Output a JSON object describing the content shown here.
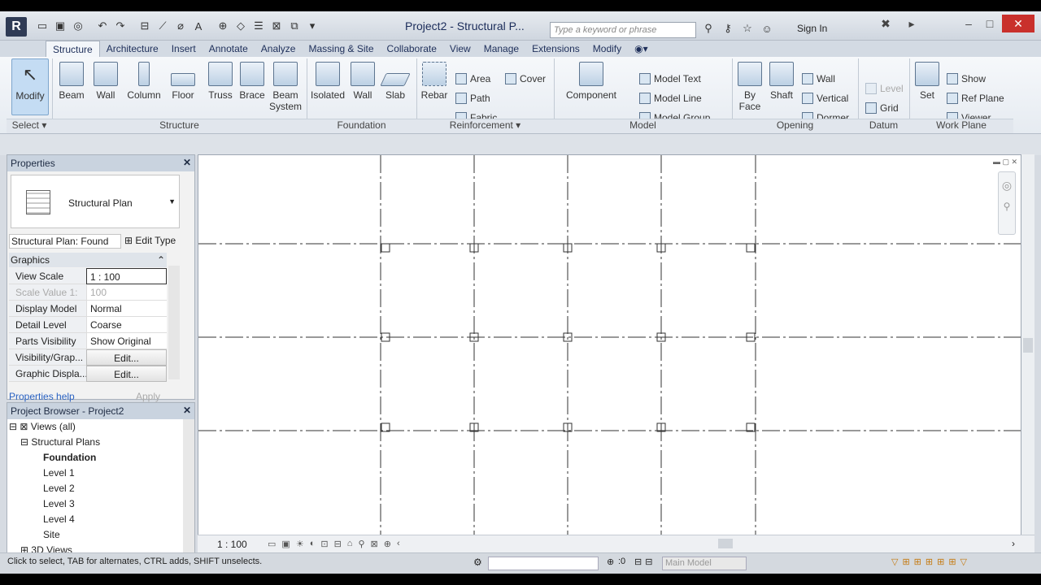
{
  "titlebar": {
    "logo": "R",
    "title": "Project2 - Structural P...",
    "search_placeholder": "Type a keyword or phrase",
    "sign_in": "Sign In"
  },
  "tabs": [
    "Structure",
    "Architecture",
    "Insert",
    "Annotate",
    "Analyze",
    "Massing & Site",
    "Collaborate",
    "View",
    "Manage",
    "Extensions",
    "Modify"
  ],
  "ribbon": {
    "modify": "Modify",
    "structure_buttons": [
      "Beam",
      "Wall",
      "Column",
      "Floor",
      "Truss",
      "Brace"
    ],
    "beam_system": [
      "Beam",
      "System"
    ],
    "foundation_buttons": [
      "Isolated",
      "Wall",
      "Slab"
    ],
    "rebar": "Rebar",
    "reinf_small": [
      "Area",
      "Path",
      "Fabric"
    ],
    "cover": "Cover",
    "component": "Component",
    "model_small": [
      "Model  Text",
      "Model  Line",
      "Model  Group"
    ],
    "by_face": [
      "By",
      "Face"
    ],
    "shaft": "Shaft",
    "opening_small": [
      "Wall",
      "Vertical",
      "Dormer"
    ],
    "level": "Level",
    "grid": "Grid",
    "set": "Set",
    "workplane_small": [
      "Show",
      "Ref  Plane",
      "Viewer"
    ],
    "groups": {
      "select": "Select",
      "structure": "Structure",
      "foundation": "Foundation",
      "reinforcement": "Reinforcement",
      "model": "Model",
      "opening": "Opening",
      "datum": "Datum",
      "workplane": "Work Plane"
    }
  },
  "properties": {
    "title": "Properties",
    "type_name": "Structural Plan",
    "instance": "Structural Plan: Found",
    "edit_type": "Edit Type",
    "section": "Graphics",
    "rows": [
      {
        "k": "View Scale",
        "v": "1 : 100"
      },
      {
        "k": "Scale Value    1:",
        "v": "100"
      },
      {
        "k": "Display Model",
        "v": "Normal"
      },
      {
        "k": "Detail Level",
        "v": "Coarse"
      },
      {
        "k": "Parts Visibility",
        "v": "Show Original"
      },
      {
        "k": "Visibility/Grap...",
        "v": "Edit..."
      },
      {
        "k": "Graphic Displa...",
        "v": "Edit..."
      }
    ],
    "help": "Properties help",
    "apply": "Apply"
  },
  "browser": {
    "title": "Project Browser - Project2",
    "views": "Views (all)",
    "structural_plans": "Structural Plans",
    "items": [
      "Foundation",
      "Level 1",
      "Level 2",
      "Level 3",
      "Level 4",
      "Site"
    ],
    "next": "3D Views"
  },
  "viewbar": {
    "scale": "1 : 100"
  },
  "status": {
    "text": "Click to select, TAB for alternates, CTRL adds, SHIFT unselects.",
    "zero": ":0",
    "main_model": "Main Model"
  }
}
